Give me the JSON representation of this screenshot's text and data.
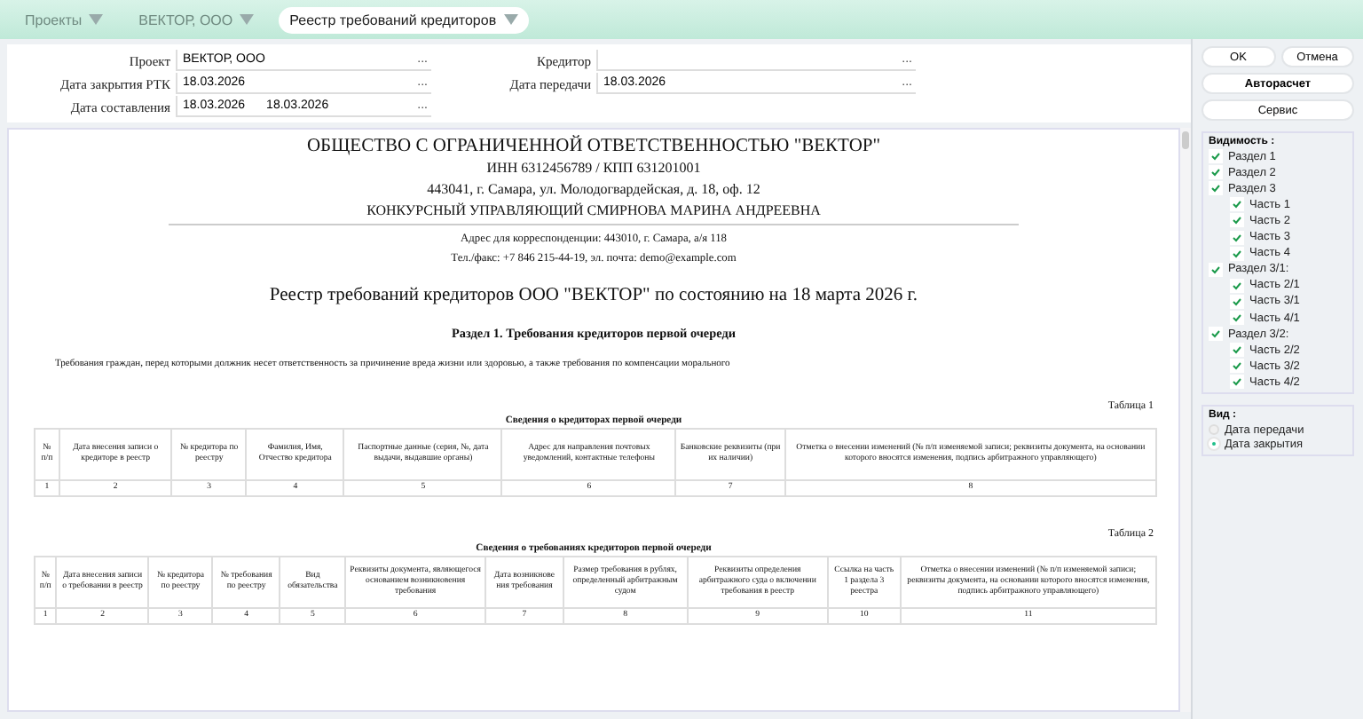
{
  "breadcrumbs": [
    {
      "label": "Проекты",
      "selected": false
    },
    {
      "label": "ВЕКТОР, ООО",
      "selected": false
    },
    {
      "label": "Реестр требований кредиторов",
      "selected": true
    }
  ],
  "form": {
    "left": [
      {
        "label": "Проект",
        "value": "ВЕКТОР, ООО"
      },
      {
        "label": "Дата закрытия РТК",
        "value": "18.03.2026"
      },
      {
        "label": "Дата составления",
        "value": "18.03.2026",
        "extra": "18.03.2026"
      }
    ],
    "right": [
      {
        "label": "Кредитор"
      },
      {
        "label": "Дата передачи",
        "value": "18.03.2026"
      }
    ],
    "picker": "..."
  },
  "document": {
    "header": [
      "ОБЩЕСТВО С ОГРАНИЧЕННОЙ ОТВЕТСТВЕННОСТЬЮ \"ВЕКТОР\"",
      "ИНН 6312456789 / КПП 631201001",
      "443041, г. Самара, ул. Молодогвардейская, д. 18, оф. 12",
      "КОНКУРСНЫЙ УПРАВЛЯЮЩИЙ СМИРНОВА МАРИНА АНДРЕЕВНА"
    ],
    "contacts": [
      "Адрес для корреспонденции: 443010, г. Самара, а/я 118",
      "Тел./факс: +7 846 215-44-19, эл. почта: demo@example.com"
    ],
    "title": "Реестр требований кредиторов ООО \"ВЕКТОР\" по состоянию на 18 марта 2026 г.",
    "section": "Раздел 1. Требования кредиторов первой очереди",
    "intro": "Требования граждан, перед которыми должник несет ответственность за причинение вреда жизни или здоровью, а также требования по компенсации морального",
    "tables": [
      {
        "number": "Таблица 1",
        "caption": "Сведения о кредиторах первой очереди",
        "columns": [
          {
            "header": "№ п/п",
            "index": "1"
          },
          {
            "header": "Дата внесения записи о кредиторе в реестр",
            "index": "2"
          },
          {
            "header": "№ кредитора по реестру",
            "index": "3"
          },
          {
            "header": "Фамилия, Имя, Отчество кредитора",
            "index": "4"
          },
          {
            "header": "Паспортные данные (серия, №, дата выдачи, выдавшие органы)",
            "index": "5"
          },
          {
            "header": "Адрес для направления почтовых уведомлений, контактные телефоны",
            "index": "6"
          },
          {
            "header": "Банковские реквизиты (при их наличии)",
            "index": "7"
          },
          {
            "header": "Отметка о внесении изменений (№ п/п изменяемой записи; реквизиты документа, на основании которого вносятся изменения, подпись арбитражного управляющего)",
            "index": "8"
          }
        ]
      },
      {
        "number": "Таблица 2",
        "caption": "Сведения о требованиях кредиторов первой очереди",
        "columns": [
          {
            "header": "№ п/п",
            "index": "1"
          },
          {
            "header": "Дата внесения записи о требовании в реестр",
            "index": "2"
          },
          {
            "header": "№ кредитора по реестру",
            "index": "3"
          },
          {
            "header": "№ требования по реестру",
            "index": "4"
          },
          {
            "header": "Вид обязательства",
            "index": "5"
          },
          {
            "header": "Реквизиты документа, являющегося основанием возникновения требования",
            "index": "6"
          },
          {
            "header": "Дата возникнове ния требования",
            "index": "7"
          },
          {
            "header": "Размер требования в рублях, определенный арбитражным судом",
            "index": "8"
          },
          {
            "header": "Реквизиты определения арбитражного суда о включении требования в реестр",
            "index": "9"
          },
          {
            "header": "Ссылка на часть 1 раздела 3 реестра",
            "index": "10"
          },
          {
            "header": "Отметка о внесении изменений (№ п/п изменяемой записи; реквизиты документа, на основании которого вносятся изменения, подпись арбитражного управляющего)",
            "index": "11"
          }
        ]
      }
    ]
  },
  "actions": {
    "ok": "OK",
    "cancel": "Отмена",
    "auto": "Авторасчет",
    "service": "Сервис"
  },
  "visibility": {
    "title": "Видимость :",
    "items": [
      {
        "label": "Раздел 1",
        "checked": true
      },
      {
        "label": "Раздел 2",
        "checked": true
      },
      {
        "label": "Раздел 3",
        "checked": true,
        "children": [
          {
            "label": "Часть 1",
            "checked": true
          },
          {
            "label": "Часть 2",
            "checked": true
          },
          {
            "label": "Часть 3",
            "checked": true
          },
          {
            "label": "Часть 4",
            "checked": true
          }
        ]
      },
      {
        "label": "Раздел 3/1:",
        "checked": true,
        "children": [
          {
            "label": "Часть 2/1",
            "checked": true
          },
          {
            "label": "Часть 3/1",
            "checked": true
          },
          {
            "label": "Часть 4/1",
            "checked": true
          }
        ]
      },
      {
        "label": "Раздел 3/2:",
        "checked": true,
        "children": [
          {
            "label": "Часть 2/2",
            "checked": true
          },
          {
            "label": "Часть 3/2",
            "checked": true
          },
          {
            "label": "Часть 4/2",
            "checked": true
          }
        ]
      }
    ]
  },
  "view": {
    "title": "Вид :",
    "options": [
      {
        "label": "Дата передачи",
        "selected": false
      },
      {
        "label": "Дата закрытия",
        "selected": true
      }
    ]
  }
}
